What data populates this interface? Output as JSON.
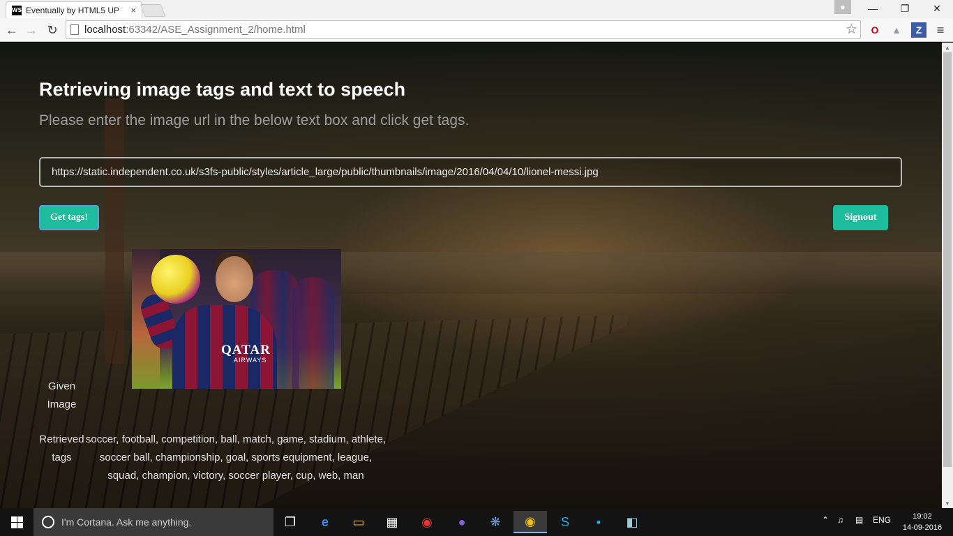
{
  "browser": {
    "tab_title": "Eventually by HTML5 UP",
    "tab_icon_text": "WS",
    "tab_close": "×",
    "url_host": "localhost",
    "url_path": ":63342/ASE_Assignment_2/home.html",
    "ext_z_label": "Z"
  },
  "page": {
    "heading": "Retrieving image tags and text to speech",
    "subheading": "Please enter the image url in the below text box and click get tags.",
    "url_value": "https://static.independent.co.uk/s3fs-public/styles/article_large/public/thumbnails/image/2016/04/04/10/lionel-messi.jpg",
    "get_tags_label": "Get tags!",
    "signout_label": "Signout",
    "photo_sponsor": "QATAR",
    "photo_sponsor_sub": "AIRWAYS",
    "given_image_label": "Given Image",
    "retrieved_tags_label": "Retrieved tags",
    "tags": "soccer, football, competition, ball, match, game, stadium, athlete, soccer ball, championship, goal, sports equipment, league, squad, champion, victory, soccer player, cup, web, man",
    "accent_color": "#1cbc9c"
  },
  "taskbar": {
    "cortana_placeholder": "I'm Cortana. Ask me anything.",
    "language": "ENG",
    "time": "19:02",
    "date": "14-09-2016"
  }
}
